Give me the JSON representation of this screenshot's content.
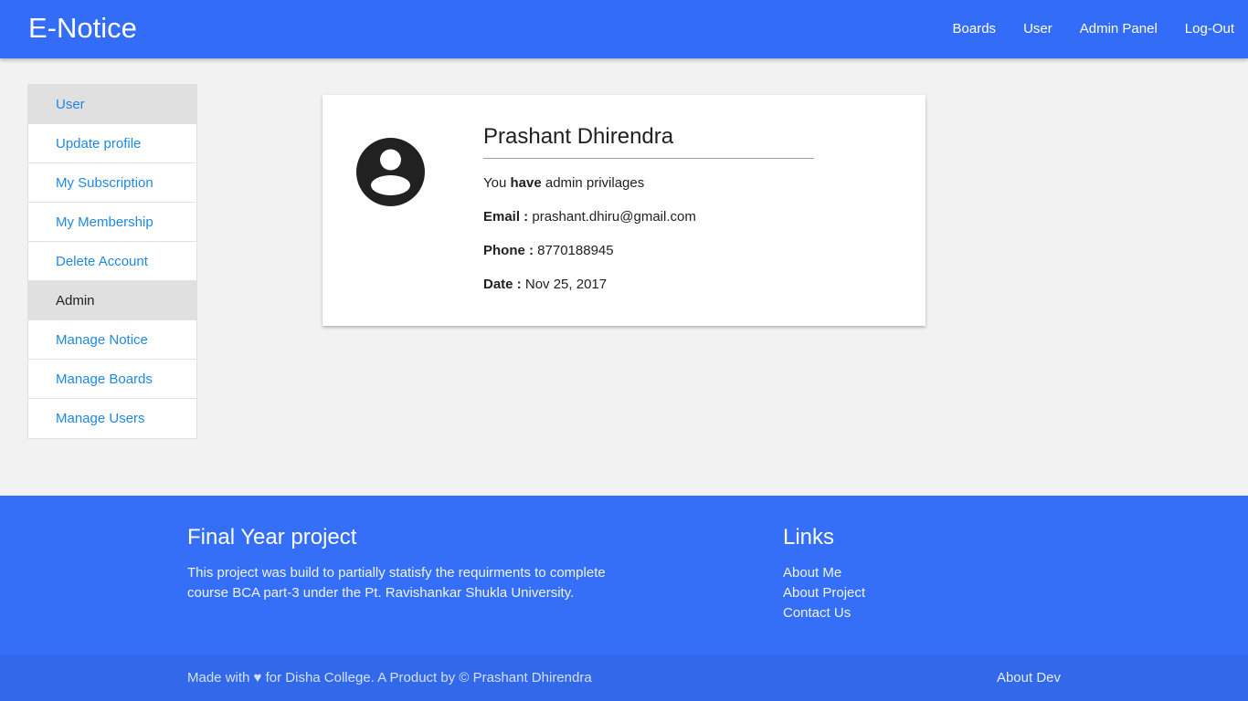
{
  "header": {
    "brand": "E-Notice",
    "nav": [
      "Boards",
      "User",
      "Admin Panel",
      "Log-Out"
    ]
  },
  "sidebar": {
    "user_header": "User",
    "user_items": [
      "Update profile",
      "My Subscription",
      "My Membership",
      "Delete Account"
    ],
    "admin_header": "Admin",
    "admin_items": [
      "Manage Notice",
      "Manage Boards",
      "Manage Users"
    ]
  },
  "profile": {
    "avatar_icon": "account-circle-icon",
    "name": "Prashant Dhirendra",
    "privilege_prefix": "You",
    "privilege_bold": "have",
    "privilege_suffix": "admin privilages",
    "email_label": "Email :",
    "email": "prashant.dhiru@gmail.com",
    "phone_label": "Phone :",
    "phone": "8770188945",
    "date_label": "Date :",
    "date": "Nov 25, 2017"
  },
  "footer": {
    "project_title": "Final Year project",
    "project_text": "This project was build to partially statisfy the requirments to complete course BCA part-3 under the Pt. Ravishankar Shukla University.",
    "links_title": "Links",
    "links": [
      "About Me",
      "About Project",
      "Contact Us"
    ],
    "copyright": "Made with ♥ for Disha College. A Product by © Prashant Dhirendra",
    "about_dev": "About Dev"
  },
  "colors": {
    "primary": "#336cf6",
    "link": "#1e88e5",
    "sidebar_header_bg": "#e0e0e0"
  }
}
